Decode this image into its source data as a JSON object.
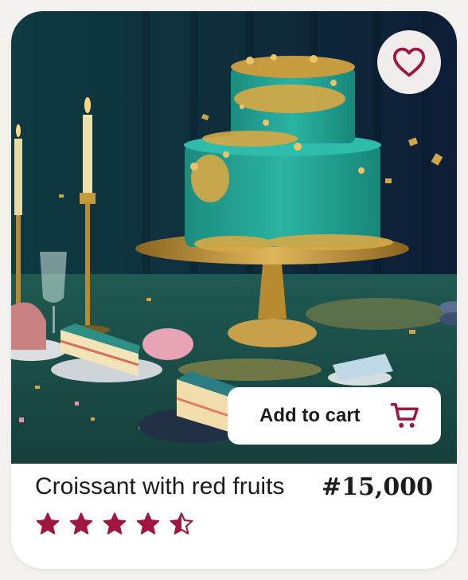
{
  "product": {
    "name": "Croissant with red fruits",
    "price": "#15,000",
    "rating": 4.5,
    "rating_max": 5
  },
  "actions": {
    "add_to_cart_label": "Add to cart"
  },
  "icons": {
    "favorite": "heart-icon",
    "cart": "shopping-cart-icon",
    "rating": "star-icon"
  },
  "colors": {
    "accent": "#a0163f",
    "text": "#1c1c1c",
    "card": "#ffffff",
    "fav_bg": "#f2eded"
  }
}
